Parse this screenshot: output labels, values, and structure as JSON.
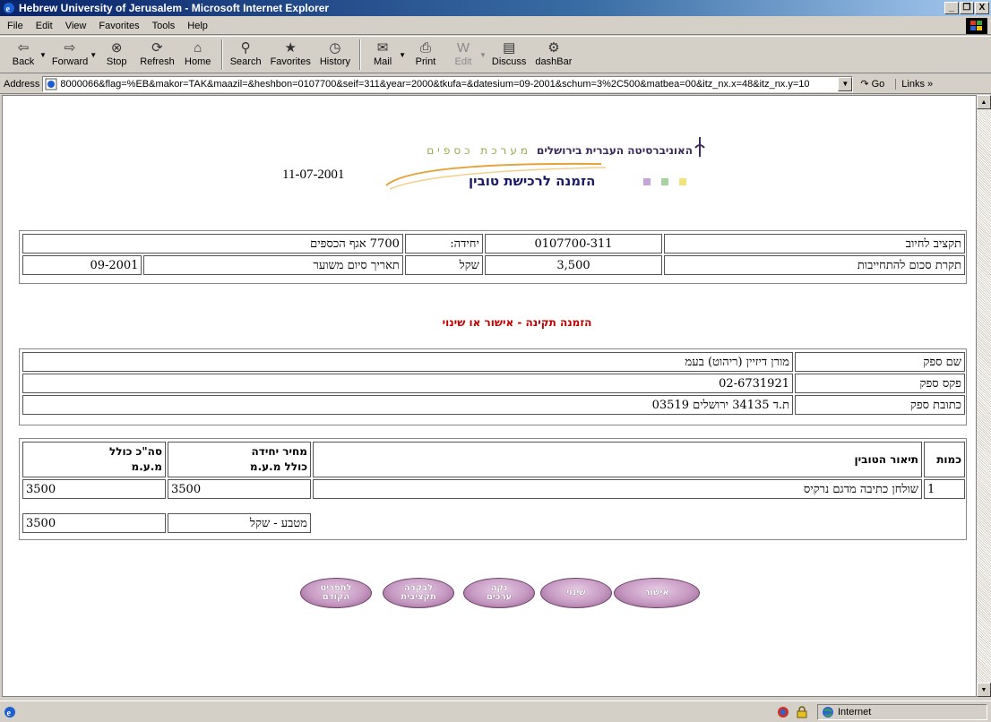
{
  "window": {
    "title": "Hebrew University of Jerusalem - Microsoft Internet Explorer",
    "min": "_",
    "max": "&#9633;",
    "close": "X"
  },
  "menu": [
    "File",
    "Edit",
    "View",
    "Favorites",
    "Tools",
    "Help"
  ],
  "toolbar": {
    "back": "Back",
    "forward": "Forward",
    "stop": "Stop",
    "refresh": "Refresh",
    "home": "Home",
    "search": "Search",
    "favorites": "Favorites",
    "history": "History",
    "mail": "Mail",
    "print": "Print",
    "edit": "Edit",
    "discuss": "Discuss",
    "dashbar": "dashBar"
  },
  "address": {
    "label": "Address",
    "url": "8000066&flag=%EB&makor=TAK&maazil=&heshbon=0107700&seif=311&year=2000&tkufa=&datesium=09-2001&schum=3%2C500&matbea=00&itz_nx.x=48&itz_nx.y=10",
    "go": "Go",
    "links": "Links »"
  },
  "header": {
    "date": "11-07-2001",
    "univ_name": "האוניברסיטה העברית בירושלים",
    "division": "מערכת כספים",
    "form_title": "הזמנה לרכישת טובין"
  },
  "budget": {
    "budget_label": "תקציב לחיוב",
    "budget_value": "0107700-311",
    "unit_label": "יחידה:",
    "unit_value": "7700 אגף הכספים",
    "cap_label": "תקרת סכום להתחייבות",
    "cap_value": "3,500",
    "currency": "שקל",
    "end_label": "תאריך סיום משוער",
    "end_value": "09-2001"
  },
  "section_heading": "הזמנה תקינה - אישור או שינוי",
  "supplier": {
    "name_label": "שם ספק",
    "name_value": "מורן דיזיין (ריהוט) בעמ",
    "fax_label": "פקס ספק",
    "fax_value": "02-6731921",
    "addr_label": "כתובת ספק",
    "addr_value": "ת.ד 34135 ירושלים 03519"
  },
  "items": {
    "headers": {
      "qty": "כמות",
      "desc": "תיאור הטובין",
      "unit_price": "מחיר יחידה\nכולל מ.ע.מ",
      "total": "סה\"כ כולל\nמ.ע.מ"
    },
    "rows": [
      {
        "qty": "1",
        "desc": "שולחן כתיבה מדגם נרקיס",
        "unit_price": "3500",
        "total": "3500"
      }
    ],
    "currency_label": "מטבע - שקל",
    "grand_total": "3500"
  },
  "buttons": {
    "approve": "אישור",
    "change": "שינוי",
    "clear": "נקה\nערכים",
    "budget_check": "לבקרה\nתקציבית",
    "prev_menu": "לתפריט\nהקודם"
  },
  "status": {
    "zone": "Internet"
  }
}
